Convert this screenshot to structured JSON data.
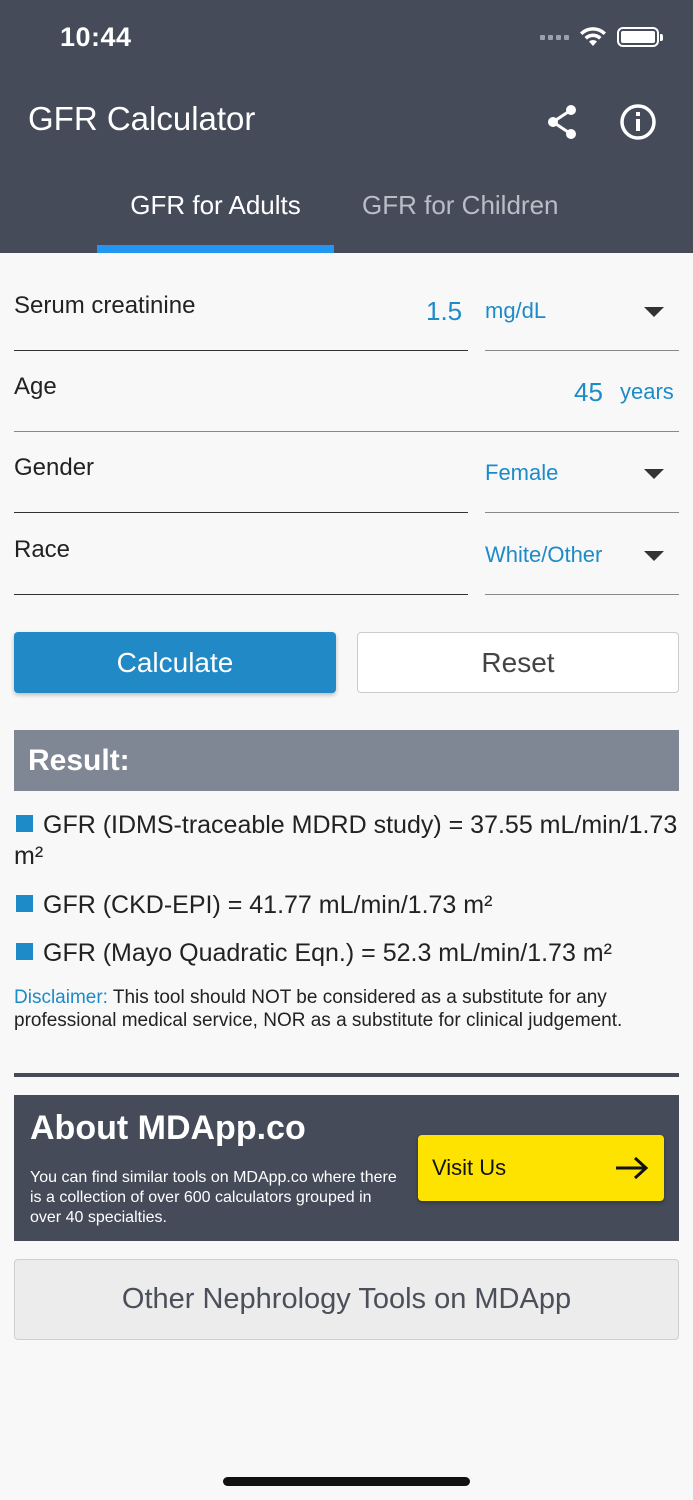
{
  "status_bar": {
    "time": "10:44"
  },
  "app": {
    "title": "GFR Calculator"
  },
  "tabs": [
    {
      "label": "GFR for Adults",
      "selected": true
    },
    {
      "label": "GFR for Children",
      "selected": false
    }
  ],
  "form": {
    "serum_creatinine": {
      "label": "Serum creatinine",
      "value": "1.5",
      "unit": "mg/dL"
    },
    "age": {
      "label": "Age",
      "value": "45",
      "unit": "years"
    },
    "gender": {
      "label": "Gender",
      "value": "Female"
    },
    "race": {
      "label": "Race",
      "value": "White/Other"
    }
  },
  "buttons": {
    "calculate": "Calculate",
    "reset": "Reset"
  },
  "result": {
    "heading": "Result:",
    "items": [
      "GFR (IDMS-traceable MDRD study) = 37.55 mL/min/1.73 m²",
      "GFR (CKD-EPI) = 41.77 mL/min/1.73 m²",
      "GFR (Mayo Quadratic Eqn.) = 52.3 mL/min/1.73 m²"
    ],
    "disclaimer_label": "Disclaimer:",
    "disclaimer_text": " This tool should NOT be considered as a substitute for any professional medical service, NOR as a substitute for clinical judgement."
  },
  "about": {
    "title": "About MDApp.co",
    "text": "You can find similar tools on MDApp.co where there is a collection of over 600 calculators grouped in over 40 specialties.",
    "visit_label": "Visit Us"
  },
  "other_tools_label": "Other Nephrology Tools on MDApp",
  "colors": {
    "appbar": "#454b59",
    "accent_blue": "#1d8bc7",
    "tab_indicator": "#2196f3",
    "result_header": "#7f8694",
    "visit_button": "#ffe300"
  },
  "icons": [
    "wifi-icon",
    "battery-icon",
    "share-icon",
    "info-icon",
    "dropdown-caret-icon",
    "arrow-right-icon"
  ]
}
